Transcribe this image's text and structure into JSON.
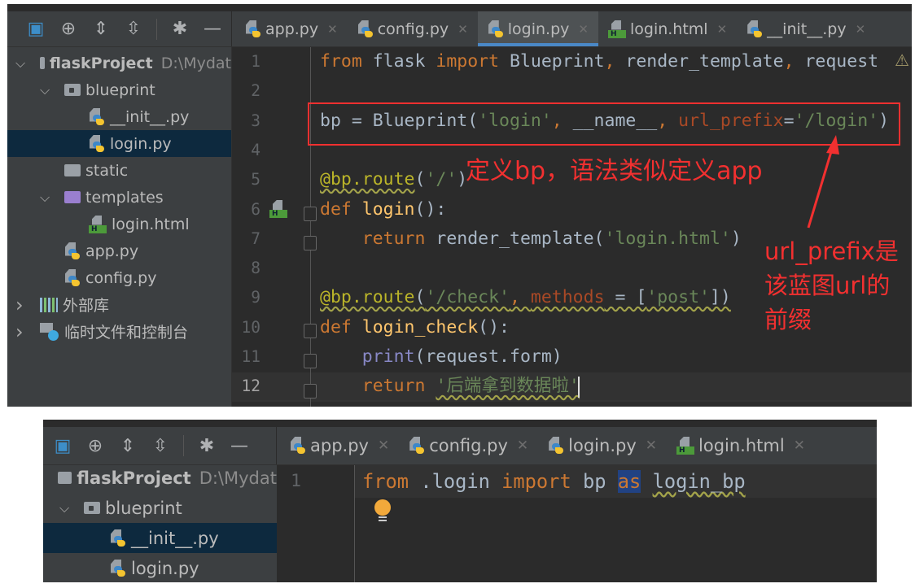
{
  "top": {
    "toolbar_icons": [
      "window-icon",
      "locate-icon",
      "expand-all-icon",
      "collapse-all-icon",
      "gear-icon",
      "minimize-icon"
    ],
    "tabs": [
      {
        "label": "app.py",
        "icon": "python-file-icon",
        "active": false
      },
      {
        "label": "config.py",
        "icon": "python-file-icon",
        "active": false
      },
      {
        "label": "login.py",
        "icon": "python-file-icon",
        "active": true
      },
      {
        "label": "login.html",
        "icon": "html-file-icon",
        "active": false
      },
      {
        "label": "__init__.py",
        "icon": "python-file-icon",
        "active": false
      }
    ],
    "tree": [
      {
        "label": "flaskProject",
        "path": "D:\\Mydat",
        "level": 0,
        "icon": "folder-icon",
        "expanded": true,
        "bold": true
      },
      {
        "label": "blueprint",
        "level": 1,
        "icon": "package-icon",
        "expanded": true
      },
      {
        "label": "__init__.py",
        "level": 2,
        "icon": "python-file-icon"
      },
      {
        "label": "login.py",
        "level": 2,
        "icon": "python-file-icon",
        "selected": true
      },
      {
        "label": "static",
        "level": 1,
        "icon": "folder-icon"
      },
      {
        "label": "templates",
        "level": 1,
        "icon": "templates-folder-icon",
        "expanded": true
      },
      {
        "label": "login.html",
        "level": 2,
        "icon": "html-file-icon"
      },
      {
        "label": "app.py",
        "level": 1,
        "icon": "python-file-icon"
      },
      {
        "label": "config.py",
        "level": 1,
        "icon": "python-file-icon"
      },
      {
        "label": "外部库",
        "level": 0,
        "icon": "library-icon",
        "collapsed": true
      },
      {
        "label": "临时文件和控制台",
        "level": 0,
        "icon": "scratches-icon",
        "collapsed": true
      }
    ],
    "code": [
      [
        [
          "from ",
          "kw"
        ],
        [
          "flask ",
          ""
        ],
        [
          "import ",
          "kw"
        ],
        [
          "Blueprint",
          ""
        ],
        [
          ", ",
          "kw"
        ],
        [
          "render_template",
          ""
        ],
        [
          ", ",
          "kw"
        ],
        [
          "request",
          ""
        ]
      ],
      [],
      [
        [
          "bp = Blueprint(",
          ""
        ],
        [
          "'login'",
          "str"
        ],
        [
          ", ",
          "kw"
        ],
        [
          "__name__",
          ""
        ],
        [
          ", ",
          "kw"
        ],
        [
          "url_prefix",
          "arg"
        ],
        [
          "=",
          ""
        ],
        [
          "'/login'",
          "str"
        ],
        [
          ")",
          ""
        ]
      ],
      [],
      [
        [
          "@bp.route",
          "dec"
        ],
        [
          "(",
          ""
        ],
        [
          "'/'",
          "str"
        ],
        [
          ")",
          ""
        ]
      ],
      [
        [
          "def ",
          "kw"
        ],
        [
          "login",
          "fn"
        ],
        [
          "():",
          ""
        ]
      ],
      [
        [
          "    return ",
          "kw"
        ],
        [
          "render_template(",
          ""
        ],
        [
          "'login.html'",
          "str"
        ],
        [
          ")",
          ""
        ]
      ],
      [],
      [
        [
          "@bp.route",
          "dec"
        ],
        [
          "(",
          ""
        ],
        [
          "'/check'",
          "str"
        ],
        [
          ", ",
          "kw"
        ],
        [
          "methods",
          "arg"
        ],
        [
          " = [",
          ""
        ],
        [
          "'post'",
          "str"
        ],
        [
          "])",
          ""
        ]
      ],
      [
        [
          "def ",
          "kw"
        ],
        [
          "login_check",
          "fn"
        ],
        [
          "():",
          ""
        ]
      ],
      [
        [
          "    print",
          "bi"
        ],
        [
          "(request.form)",
          ""
        ]
      ],
      [
        [
          "    return ",
          "kw"
        ],
        [
          "'后端拿到数据啦'",
          "str"
        ]
      ]
    ],
    "warning_icon": "warning-icon",
    "annotation_main": "定义bp，语法类似定义app",
    "annotation_side": [
      "url_prefix是",
      "该蓝图url的",
      "前缀"
    ]
  },
  "bottom": {
    "tabs": [
      {
        "label": "app.py",
        "active": false
      },
      {
        "label": "config.py",
        "active": false
      },
      {
        "label": "login.py",
        "active": false
      },
      {
        "label": "login.html",
        "active": false
      }
    ],
    "tree": [
      {
        "label": "flaskProject",
        "path": "D:\\Mydat",
        "level": 0,
        "icon": "folder-icon",
        "expanded": true,
        "bold": true
      },
      {
        "label": "blueprint",
        "level": 1,
        "icon": "package-icon",
        "expanded": true
      },
      {
        "label": "__init__.py",
        "level": 2,
        "icon": "python-file-icon",
        "selected": true
      },
      {
        "label": "login.py",
        "level": 2,
        "icon": "python-file-icon"
      }
    ],
    "code": [
      [
        [
          "from ",
          "kw"
        ],
        [
          ".login ",
          ""
        ],
        [
          "import ",
          "kw"
        ],
        [
          "bp ",
          ""
        ],
        [
          "as",
          "kw"
        ],
        [
          " ",
          ""
        ],
        [
          "login_bp",
          ""
        ]
      ]
    ],
    "bulb_icon": "lightbulb-icon"
  },
  "colors": {
    "kw": "#cc7832",
    "str": "#6a8759",
    "fn": "#ffc66d",
    "dec": "#bbb529",
    "arg": "#aa4926",
    "bi": "#8888c6",
    "annotation": "#f23030",
    "accent": "#4a88c7"
  }
}
